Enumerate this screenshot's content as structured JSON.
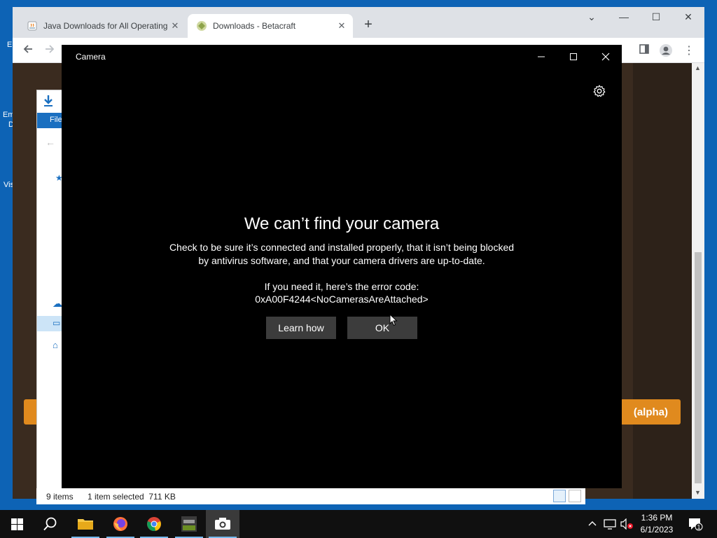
{
  "desktop": {
    "fragments": [
      "E",
      "Em",
      "D",
      "Vis"
    ]
  },
  "browser": {
    "tabs": [
      {
        "title": "Java Downloads for All Operating",
        "favicon": "java-icon"
      },
      {
        "title": "Downloads - Betacraft",
        "favicon": "betacraft-icon",
        "active": true
      }
    ],
    "website": {
      "button_label": "(alpha)"
    }
  },
  "explorer": {
    "ribbon_file": "File",
    "status_items": "9 items",
    "status_selected": "1 item selected  711 KB"
  },
  "camera": {
    "window_title": "Camera",
    "error_title": "We can’t find your camera",
    "error_line1": "Check to be sure it’s connected and installed properly, that it isn’t being blocked",
    "error_line2": "by antivirus software, and that your camera drivers are up-to-date.",
    "code_intro": "If you need it, here’s the error code:",
    "error_code": "0xA00F4244<NoCamerasAreAttached>",
    "learn_how": "Learn how",
    "ok": "OK"
  },
  "taskbar": {
    "apps": [
      "file-explorer",
      "firefox",
      "chrome",
      "minecraft-launcher",
      "camera"
    ],
    "time": "1:36 PM",
    "date": "6/1/2023",
    "notifications": "1"
  },
  "colors": {
    "taskbar": "#101010",
    "desktop": "#0d63b5",
    "accent_orange": "#e08a1e"
  }
}
